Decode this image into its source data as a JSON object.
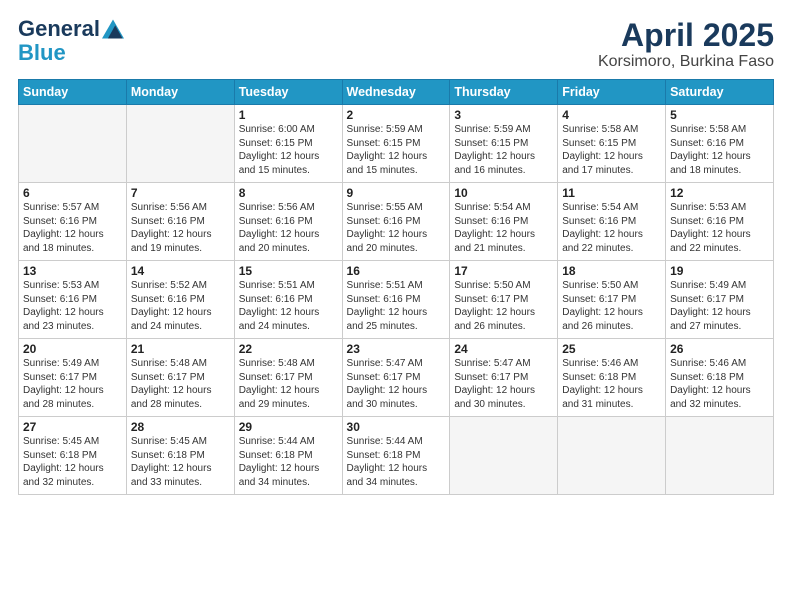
{
  "logo": {
    "general": "General",
    "blue": "Blue"
  },
  "title": "April 2025",
  "subtitle": "Korsimoro, Burkina Faso",
  "weekdays": [
    "Sunday",
    "Monday",
    "Tuesday",
    "Wednesday",
    "Thursday",
    "Friday",
    "Saturday"
  ],
  "weeks": [
    [
      {
        "day": "",
        "info": ""
      },
      {
        "day": "",
        "info": ""
      },
      {
        "day": "1",
        "info": "Sunrise: 6:00 AM\nSunset: 6:15 PM\nDaylight: 12 hours and 15 minutes."
      },
      {
        "day": "2",
        "info": "Sunrise: 5:59 AM\nSunset: 6:15 PM\nDaylight: 12 hours and 15 minutes."
      },
      {
        "day": "3",
        "info": "Sunrise: 5:59 AM\nSunset: 6:15 PM\nDaylight: 12 hours and 16 minutes."
      },
      {
        "day": "4",
        "info": "Sunrise: 5:58 AM\nSunset: 6:15 PM\nDaylight: 12 hours and 17 minutes."
      },
      {
        "day": "5",
        "info": "Sunrise: 5:58 AM\nSunset: 6:16 PM\nDaylight: 12 hours and 18 minutes."
      }
    ],
    [
      {
        "day": "6",
        "info": "Sunrise: 5:57 AM\nSunset: 6:16 PM\nDaylight: 12 hours and 18 minutes."
      },
      {
        "day": "7",
        "info": "Sunrise: 5:56 AM\nSunset: 6:16 PM\nDaylight: 12 hours and 19 minutes."
      },
      {
        "day": "8",
        "info": "Sunrise: 5:56 AM\nSunset: 6:16 PM\nDaylight: 12 hours and 20 minutes."
      },
      {
        "day": "9",
        "info": "Sunrise: 5:55 AM\nSunset: 6:16 PM\nDaylight: 12 hours and 20 minutes."
      },
      {
        "day": "10",
        "info": "Sunrise: 5:54 AM\nSunset: 6:16 PM\nDaylight: 12 hours and 21 minutes."
      },
      {
        "day": "11",
        "info": "Sunrise: 5:54 AM\nSunset: 6:16 PM\nDaylight: 12 hours and 22 minutes."
      },
      {
        "day": "12",
        "info": "Sunrise: 5:53 AM\nSunset: 6:16 PM\nDaylight: 12 hours and 22 minutes."
      }
    ],
    [
      {
        "day": "13",
        "info": "Sunrise: 5:53 AM\nSunset: 6:16 PM\nDaylight: 12 hours and 23 minutes."
      },
      {
        "day": "14",
        "info": "Sunrise: 5:52 AM\nSunset: 6:16 PM\nDaylight: 12 hours and 24 minutes."
      },
      {
        "day": "15",
        "info": "Sunrise: 5:51 AM\nSunset: 6:16 PM\nDaylight: 12 hours and 24 minutes."
      },
      {
        "day": "16",
        "info": "Sunrise: 5:51 AM\nSunset: 6:16 PM\nDaylight: 12 hours and 25 minutes."
      },
      {
        "day": "17",
        "info": "Sunrise: 5:50 AM\nSunset: 6:17 PM\nDaylight: 12 hours and 26 minutes."
      },
      {
        "day": "18",
        "info": "Sunrise: 5:50 AM\nSunset: 6:17 PM\nDaylight: 12 hours and 26 minutes."
      },
      {
        "day": "19",
        "info": "Sunrise: 5:49 AM\nSunset: 6:17 PM\nDaylight: 12 hours and 27 minutes."
      }
    ],
    [
      {
        "day": "20",
        "info": "Sunrise: 5:49 AM\nSunset: 6:17 PM\nDaylight: 12 hours and 28 minutes."
      },
      {
        "day": "21",
        "info": "Sunrise: 5:48 AM\nSunset: 6:17 PM\nDaylight: 12 hours and 28 minutes."
      },
      {
        "day": "22",
        "info": "Sunrise: 5:48 AM\nSunset: 6:17 PM\nDaylight: 12 hours and 29 minutes."
      },
      {
        "day": "23",
        "info": "Sunrise: 5:47 AM\nSunset: 6:17 PM\nDaylight: 12 hours and 30 minutes."
      },
      {
        "day": "24",
        "info": "Sunrise: 5:47 AM\nSunset: 6:17 PM\nDaylight: 12 hours and 30 minutes."
      },
      {
        "day": "25",
        "info": "Sunrise: 5:46 AM\nSunset: 6:18 PM\nDaylight: 12 hours and 31 minutes."
      },
      {
        "day": "26",
        "info": "Sunrise: 5:46 AM\nSunset: 6:18 PM\nDaylight: 12 hours and 32 minutes."
      }
    ],
    [
      {
        "day": "27",
        "info": "Sunrise: 5:45 AM\nSunset: 6:18 PM\nDaylight: 12 hours and 32 minutes."
      },
      {
        "day": "28",
        "info": "Sunrise: 5:45 AM\nSunset: 6:18 PM\nDaylight: 12 hours and 33 minutes."
      },
      {
        "day": "29",
        "info": "Sunrise: 5:44 AM\nSunset: 6:18 PM\nDaylight: 12 hours and 34 minutes."
      },
      {
        "day": "30",
        "info": "Sunrise: 5:44 AM\nSunset: 6:18 PM\nDaylight: 12 hours and 34 minutes."
      },
      {
        "day": "",
        "info": ""
      },
      {
        "day": "",
        "info": ""
      },
      {
        "day": "",
        "info": ""
      }
    ]
  ]
}
